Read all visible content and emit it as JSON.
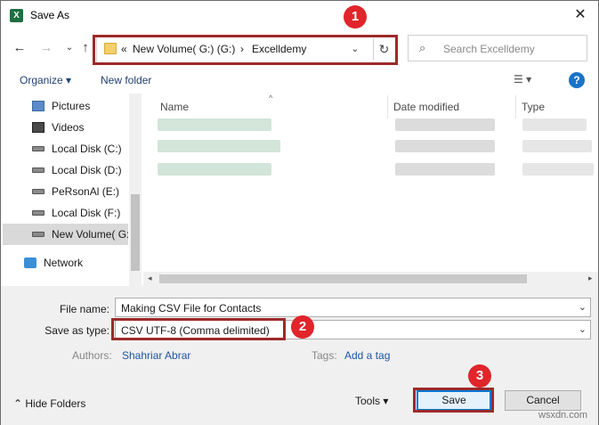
{
  "window": {
    "app_icon": "excel-icon",
    "title": "Save As",
    "close_glyph": "✕"
  },
  "nav": {
    "back_glyph": "←",
    "forward_glyph": "→",
    "recent_glyph": "⌄",
    "up_glyph": "↑",
    "address": {
      "overflow": "«",
      "crumbs": [
        "New Volume( G:) (G:)",
        "Excelldemy"
      ],
      "separator": "›",
      "dropdown_glyph": "⌄",
      "refresh_glyph": "↻"
    },
    "search": {
      "icon_glyph": "⌕",
      "placeholder": "Search Excelldemy"
    }
  },
  "toolbar": {
    "organize": "Organize ▾",
    "new_folder": "New folder",
    "view": "☰ ▾",
    "help": "?"
  },
  "sidebar": {
    "items": [
      {
        "label": "Pictures",
        "icon": "pictures-icon"
      },
      {
        "label": "Videos",
        "icon": "videos-icon"
      },
      {
        "label": "Local Disk (C:)",
        "icon": "drive-icon"
      },
      {
        "label": "Local Disk (D:)",
        "icon": "drive-icon"
      },
      {
        "label": "PeRsonAl (E:)",
        "icon": "drive-icon"
      },
      {
        "label": "Local Disk (F:)",
        "icon": "drive-icon"
      },
      {
        "label": "New Volume( G:)",
        "icon": "drive-icon",
        "selected": true
      }
    ],
    "network": {
      "label": "Network",
      "icon": "network-icon"
    }
  },
  "filelist": {
    "columns": [
      "Name",
      "Date modified",
      "Type"
    ],
    "sort_glyph": "^",
    "scroll_left": "◂",
    "scroll_right": "▸"
  },
  "form": {
    "file_name_label": "File name:",
    "file_name_value": "Making CSV File for Contacts",
    "save_type_label": "Save as type:",
    "save_type_value": "CSV UTF-8 (Comma delimited)",
    "dropdown_glyph": "⌄",
    "authors_label": "Authors:",
    "authors_value": "Shahriar Abrar",
    "tags_label": "Tags:",
    "tags_value": "Add a tag",
    "hide_folders": "⌃ Hide Folders",
    "tools": "Tools ▾",
    "save": "Save",
    "cancel": "Cancel"
  },
  "annotations": {
    "badge_1": "1",
    "badge_2": "2",
    "badge_3": "3",
    "color": "#e0252b"
  },
  "watermark": "wsxdn.com"
}
